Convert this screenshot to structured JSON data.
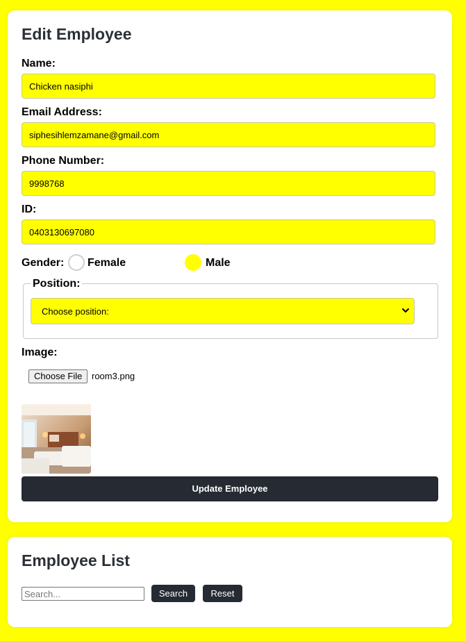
{
  "edit_form": {
    "title": "Edit Employee",
    "name_label": "Name:",
    "name_value": "Chicken nasiphi",
    "email_label": "Email Address:",
    "email_value": "siphesihlemzamane@gmail.com",
    "phone_label": "Phone Number:",
    "phone_value": "9998768",
    "id_label": "ID:",
    "id_value": "0403130697080",
    "gender": {
      "label": "Gender:",
      "options": [
        "Female",
        "Male"
      ],
      "selected": "Male"
    },
    "position": {
      "legend": "Position:",
      "selected_option": "Choose position:"
    },
    "image": {
      "label": "Image:",
      "choose_button": "Choose File",
      "file_name": "room3.png"
    },
    "submit_label": "Update Employee"
  },
  "employee_list": {
    "title": "Employee List",
    "search_placeholder": "Search...",
    "search_button": "Search",
    "reset_button": "Reset"
  },
  "colors": {
    "page_background": "#ffff00",
    "input_background": "#ffff00",
    "primary_button": "#262a33",
    "card": "#ffffff"
  },
  "icons": [
    "chevron-down-icon"
  ]
}
